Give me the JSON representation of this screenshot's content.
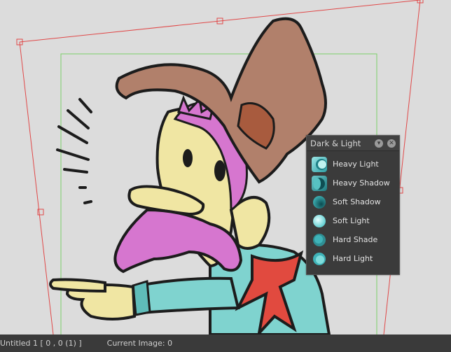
{
  "panel": {
    "title": "Dark & Light",
    "items": [
      {
        "label": "Heavy Light",
        "icon": "heavy-light-icon"
      },
      {
        "label": "Heavy Shadow",
        "icon": "heavy-shadow-icon"
      },
      {
        "label": "Soft Shadow",
        "icon": "soft-shadow-icon"
      },
      {
        "label": "Soft Light",
        "icon": "soft-light-icon"
      },
      {
        "label": "Hard Shade",
        "icon": "hard-shade-icon"
      },
      {
        "label": "Hard Light",
        "icon": "hard-light-icon"
      }
    ]
  },
  "status": {
    "document": "Untitled 1 [ 0 , 0  (1) ]",
    "current_image": "Current Image: 0"
  },
  "colors": {
    "accent_teal": "#3fb3b8",
    "transform_box": "#e04848",
    "canvas_bounds": "#7ccf6a"
  }
}
